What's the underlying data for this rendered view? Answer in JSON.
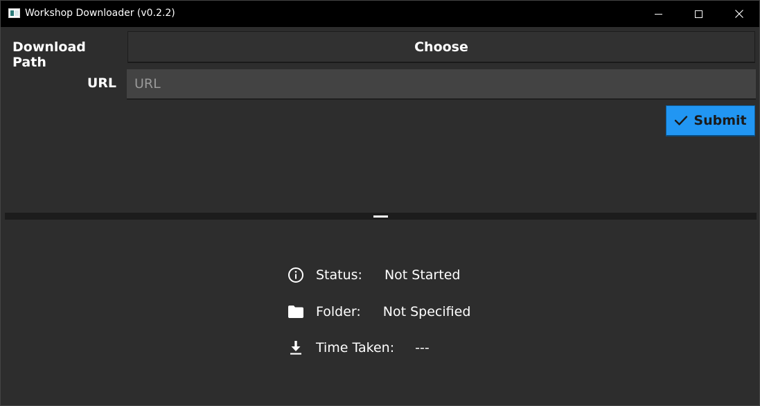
{
  "window": {
    "title": "Workshop Downloader (v0.2.2)"
  },
  "form": {
    "download_path_label": "Download Path",
    "choose_button_label": "Choose",
    "url_label": "URL",
    "url_placeholder": "URL",
    "url_value": "",
    "submit_label": "Submit",
    "submit_icon": "checkmark-icon"
  },
  "status_panel": {
    "rows": [
      {
        "icon": "info-circle-icon",
        "key": "Status:",
        "value": "Not Started"
      },
      {
        "icon": "folder-icon",
        "key": "Folder:",
        "value": "Not Specified"
      },
      {
        "icon": "download-icon",
        "key": "Time Taken:",
        "value": "---"
      }
    ]
  },
  "colors": {
    "background": "#2d2d2d",
    "titlebar": "#000000",
    "accent": "#2196f3",
    "input_bg": "#434343"
  }
}
